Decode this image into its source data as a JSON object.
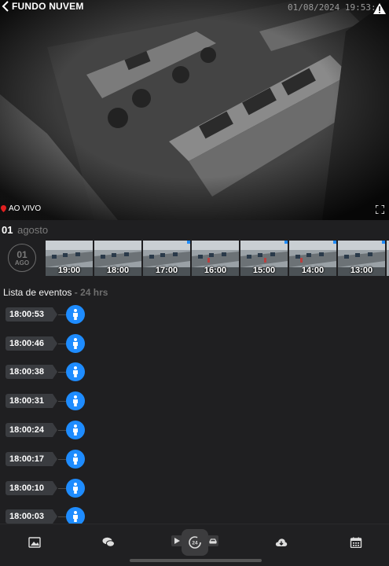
{
  "camera": {
    "title": "FUNDO NUVEM",
    "timestamp": "01/08/2024 19:53:4",
    "live_label": "AO VIVO"
  },
  "timeline": {
    "day": "01",
    "month": "agosto",
    "badge_day": "01",
    "badge_month": "AGO",
    "thumbnails": [
      "19:00",
      "18:00",
      "17:00",
      "16:00",
      "15:00",
      "14:00",
      "13:00"
    ]
  },
  "events": {
    "title": "Lista de eventos",
    "range": "- 24 hrs",
    "items": [
      "18:00:53",
      "18:00:46",
      "18:00:38",
      "18:00:31",
      "18:00:24",
      "18:00:17",
      "18:00:10",
      "18:00:03"
    ]
  },
  "bottom_nav": {
    "icons": [
      "image-icon",
      "chat-icon",
      "play-icon",
      "24h-icon",
      "car-icon",
      "cloud-download-icon",
      "calendar-icon"
    ]
  },
  "colors": {
    "accent": "#1e8cff",
    "background": "#1f1f21",
    "live_dot": "#e02020"
  }
}
